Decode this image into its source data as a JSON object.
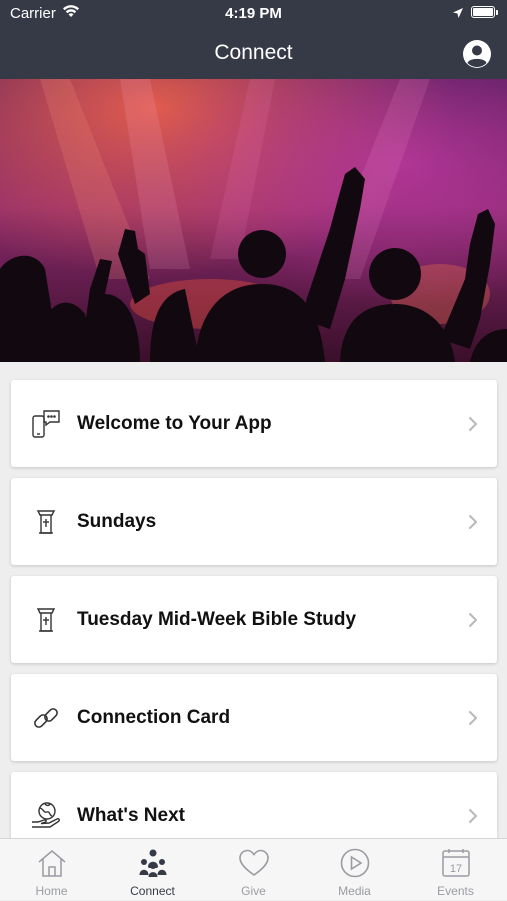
{
  "status_bar": {
    "carrier": "Carrier",
    "time": "4:19 PM",
    "icons": [
      "wifi-icon",
      "location-arrow-icon",
      "battery-icon"
    ]
  },
  "nav": {
    "title": "Connect",
    "profile_icon": "user-circle-icon"
  },
  "hero": {
    "description_icon": "hero-image"
  },
  "items": [
    {
      "label": "Welcome to Your App",
      "icon": "phone-chat-icon"
    },
    {
      "label": "Sundays",
      "icon": "pulpit-icon"
    },
    {
      "label": "Tuesday Mid-Week Bible Study",
      "icon": "pulpit-icon"
    },
    {
      "label": "Connection Card",
      "icon": "link-icon"
    },
    {
      "label": "What's Next",
      "icon": "globe-hand-icon"
    }
  ],
  "tabs": [
    {
      "label": "Home",
      "icon": "home-icon",
      "active": false
    },
    {
      "label": "Connect",
      "icon": "people-icon",
      "active": true
    },
    {
      "label": "Give",
      "icon": "heart-icon",
      "active": false
    },
    {
      "label": "Media",
      "icon": "play-circle-icon",
      "active": false
    },
    {
      "label": "Events",
      "icon": "calendar-icon",
      "active": false,
      "calendar_day": "17"
    }
  ],
  "colors": {
    "header_bg": "#363a46",
    "page_bg": "#eeeeef",
    "tab_active": "#363a46",
    "tab_inactive": "#9a9ca2"
  }
}
